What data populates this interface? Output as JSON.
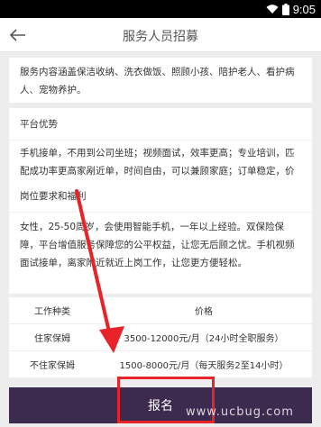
{
  "status_bar": {
    "time": "9:05",
    "wifi_icon": "wifi-icon",
    "battery_icon": "battery-icon"
  },
  "header": {
    "title": "服务人员招募",
    "back_icon": "arrow-left-icon"
  },
  "intro": {
    "text": "服务内容涵盖保洁收纳、洗衣做饭、照顾小孩、陪护老人、看护病人、宠物养护。"
  },
  "advantages": {
    "title": "平台优势",
    "text": "手机接单，不用到公司坐班；视频面试，效率更高；专业培训，匹配成功率更高家剐近单，时间自由，可以兼顾家庭；订单稳定，价格透明，不抽取任何佣金，人身意外险和财产险双保险保障。"
  },
  "requirements": {
    "title": "岗位要求和福利",
    "text": "女性，25-50周岁，会使用智能手机，一年以上经验。双保险保障，平台增值服务保障您的公平权益，让您无后顾之忧。手机视频面试接单，离家附近就近上岗工作，让您更方便轻松。"
  },
  "salary_table": {
    "headers": [
      "工作种类",
      "价格"
    ],
    "rows": [
      [
        "住家保姆",
        "3500-12000元/月（24小时全职服务）"
      ],
      [
        "不住家保姆",
        "1500-8000元/月（每天服务2至14小时）"
      ]
    ]
  },
  "cta": {
    "label": "报名"
  },
  "overlay": {
    "annotation_color": "#e8232a",
    "watermark": "www.ucbug.com"
  },
  "colors": {
    "cta_bg": "#3d2b4f",
    "page_bg": "#ededed"
  }
}
